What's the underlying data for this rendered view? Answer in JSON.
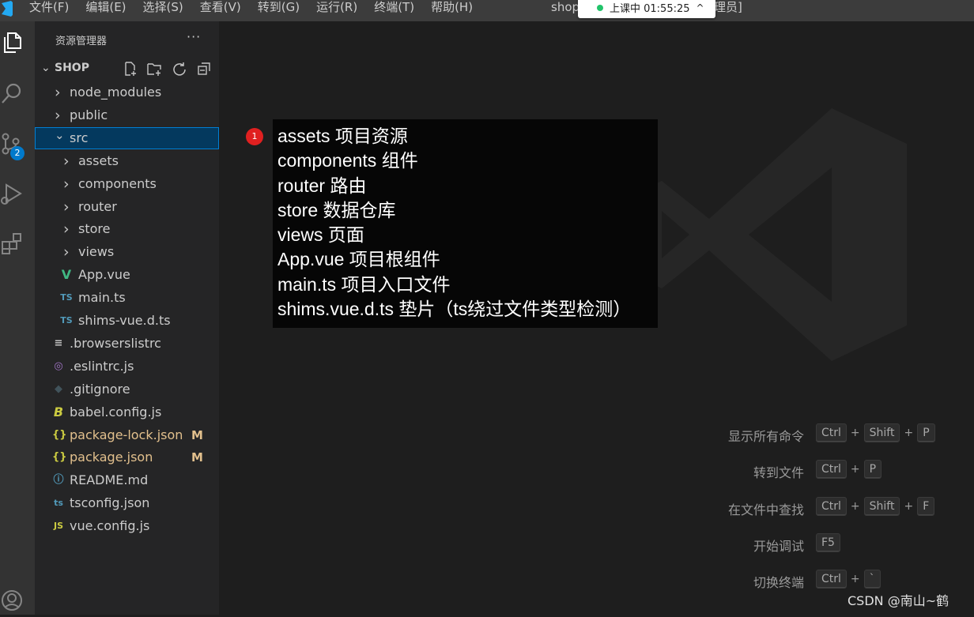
{
  "titlebar": {
    "menu": [
      "文件(F)",
      "编辑(E)",
      "选择(S)",
      "查看(V)",
      "转到(G)",
      "运行(R)",
      "终端(T)",
      "帮助(H)"
    ],
    "title_prefix": "shop",
    "title_suffix": "理员]"
  },
  "class_pill": {
    "text": "上课中 01:55:25",
    "caret": "^"
  },
  "activity_bar": {
    "icons": [
      "files-icon",
      "search-icon",
      "source-control-icon",
      "run-debug-icon",
      "extensions-icon",
      "account-icon"
    ],
    "source_control_badge": "2"
  },
  "sidebar": {
    "title": "资源管理器",
    "more": "···",
    "project": "SHOP",
    "tree": [
      {
        "label": "node_modules",
        "type": "folder",
        "expanded": false
      },
      {
        "label": "public",
        "type": "folder",
        "expanded": false
      },
      {
        "label": "src",
        "type": "folder",
        "expanded": true,
        "selected": true
      },
      {
        "label": "assets",
        "type": "folder",
        "expanded": false
      },
      {
        "label": "components",
        "type": "folder",
        "expanded": false
      },
      {
        "label": "router",
        "type": "folder",
        "expanded": false
      },
      {
        "label": "store",
        "type": "folder",
        "expanded": false
      },
      {
        "label": "views",
        "type": "folder",
        "expanded": false
      },
      {
        "label": "App.vue",
        "icon": "V"
      },
      {
        "label": "main.ts",
        "icon": "TS"
      },
      {
        "label": "shims-vue.d.ts",
        "icon": "TS"
      },
      {
        "label": ".browserslistrc",
        "icon": "≡"
      },
      {
        "label": ".eslintrc.js",
        "icon": "◎"
      },
      {
        "label": ".gitignore",
        "icon": "◆"
      },
      {
        "label": "babel.config.js",
        "icon": "B"
      },
      {
        "label": "package-lock.json",
        "icon": "{}",
        "status": "M"
      },
      {
        "label": "package.json",
        "icon": "{}",
        "status": "M"
      },
      {
        "label": "README.md",
        "icon": "ⓘ"
      },
      {
        "label": "tsconfig.json",
        "icon": "ts"
      },
      {
        "label": "vue.config.js",
        "icon": "JS"
      }
    ]
  },
  "annotation": {
    "badge": "1",
    "lines": [
      "assets 项目资源",
      "components 组件",
      "router 路由",
      "store 数据仓库",
      "views 页面",
      "App.vue 项目根组件",
      "main.ts 项目入口文件",
      "shims.vue.d.ts 垫片（ts绕过文件类型检测）"
    ]
  },
  "shortcuts": [
    {
      "label": "显示所有命令",
      "keys": [
        "Ctrl",
        "Shift",
        "P"
      ]
    },
    {
      "label": "转到文件",
      "keys": [
        "Ctrl",
        "P"
      ]
    },
    {
      "label": "在文件中查找",
      "keys": [
        "Ctrl",
        "Shift",
        "F"
      ]
    },
    {
      "label": "开始调试",
      "keys": [
        "F5"
      ]
    },
    {
      "label": "切换终端",
      "keys": [
        "Ctrl",
        "`"
      ]
    }
  ],
  "credit": "CSDN @南山~鹤",
  "colors": {
    "accent": "#007acc",
    "modified": "#e2c08d",
    "vue_green": "#41b883",
    "ts_blue": "#519aba",
    "js_yellow": "#cbcb41"
  }
}
